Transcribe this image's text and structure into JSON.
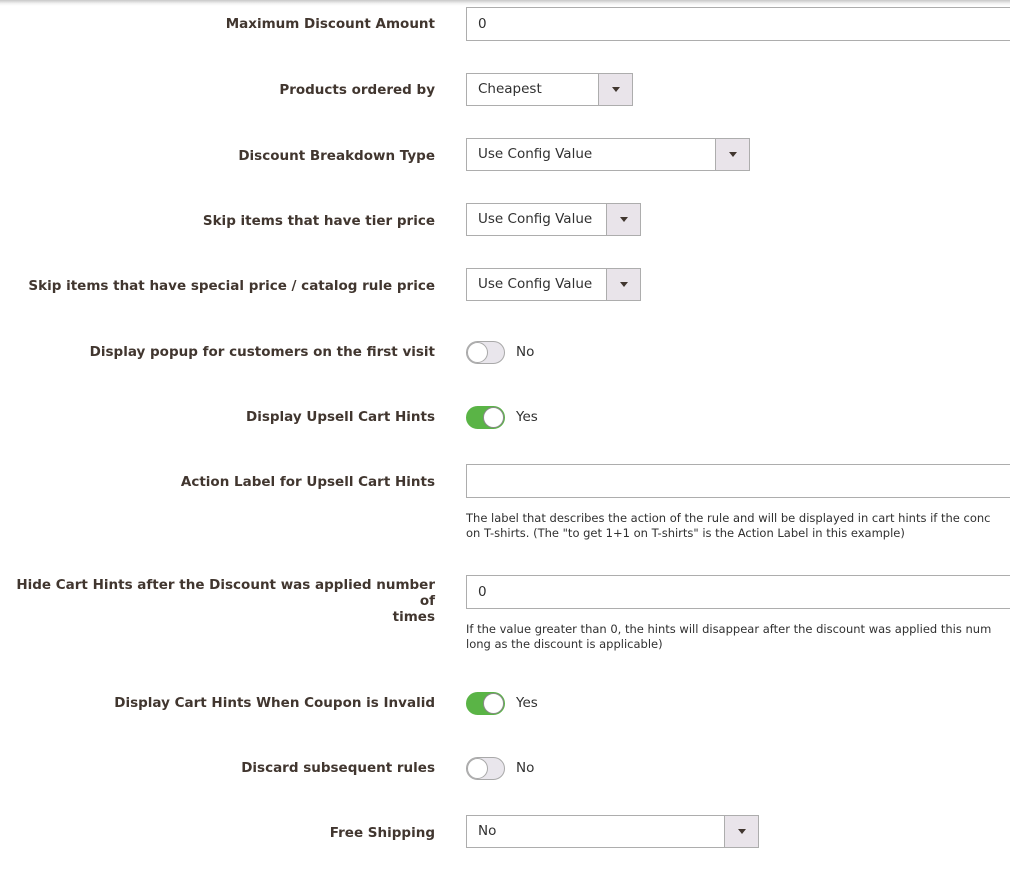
{
  "fields": {
    "max_discount": {
      "label": "Maximum Discount Amount",
      "value": "0"
    },
    "products_ordered_by": {
      "label": "Products ordered by",
      "value": "Cheapest"
    },
    "discount_breakdown": {
      "label": "Discount Breakdown Type",
      "value": "Use Config Value"
    },
    "skip_tier": {
      "label": "Skip items that have tier price",
      "value": "Use Config Value"
    },
    "skip_special": {
      "label": "Skip items that have special price / catalog rule price",
      "value": "Use Config Value"
    },
    "popup_first_visit": {
      "label": "Display popup for customers on the first visit",
      "state": "No"
    },
    "upsell_hints": {
      "label": "Display Upsell Cart Hints",
      "state": "Yes"
    },
    "action_label": {
      "label": "Action Label for Upsell Cart Hints",
      "value": "",
      "note_line1": "The label that describes the action of the rule and will be displayed in cart hints if the conc",
      "note_line2": "on T-shirts. (The \"to get 1+1 on T-shirts\" is the Action Label in this example)"
    },
    "hide_hints": {
      "label_line1": "Hide Cart Hints after the Discount was applied number of",
      "label_line2": "times",
      "value": "0",
      "note_line1": "If the value greater than 0, the hints will disappear after the discount was applied this num",
      "note_line2": "long as the discount is applicable)"
    },
    "hints_invalid_coupon": {
      "label": "Display Cart Hints When Coupon is Invalid",
      "state": "Yes"
    },
    "discard_rules": {
      "label": "Discard subsequent rules",
      "state": "No"
    },
    "free_shipping": {
      "label": "Free Shipping",
      "value": "No"
    }
  },
  "colors": {
    "toggle_on": "#5ab446",
    "label_text": "#41362f",
    "border": "#adadad",
    "select_button": "#e9e4ea"
  }
}
